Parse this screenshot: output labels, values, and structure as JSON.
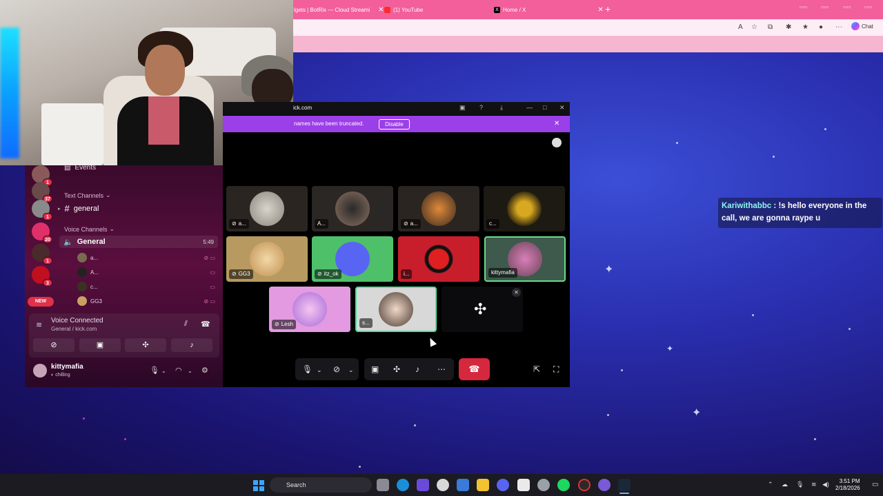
{
  "browser": {
    "tabs": [
      {
        "label": "lgets | BotRix — Cloud Streami"
      },
      {
        "label": "(1) YouTube"
      },
      {
        "label": "Home / X"
      }
    ],
    "chat_label": "Chat"
  },
  "popout": {
    "title": "ick.com",
    "notice_text": "names have been truncated.",
    "notice_button": "Disable"
  },
  "discord": {
    "events_label": "Events",
    "text_channels_label": "Text Channels",
    "text_channel": "general",
    "voice_channels_label": "Voice Channels",
    "voice_channel": "General",
    "voice_time": "5:49",
    "voice_users": [
      "a...",
      "A...",
      "c...",
      "GG3"
    ],
    "guild_badges": [
      "1",
      "37",
      "1",
      "20",
      "1",
      "3"
    ],
    "new_badge": "NEW",
    "voice_connected": "Voice Connected",
    "voice_connected_sub": "General / kick.com",
    "username": "kittymafia",
    "user_status": "chilling"
  },
  "tiles": [
    {
      "label": "a..."
    },
    {
      "label": "A..."
    },
    {
      "label": "a..."
    },
    {
      "label": "c..."
    },
    {
      "label": "GG3"
    },
    {
      "label": "itz_ok"
    },
    {
      "label": "i..."
    },
    {
      "label": "kittymafia"
    },
    {
      "label": "Lesh"
    },
    {
      "label": "s..."
    }
  ],
  "overlay": {
    "name": "Kariwithabbc",
    "message": " : !s hello everyone in the call, we are gonna raype u"
  },
  "taskbar": {
    "search_placeholder": "Search",
    "time": "3:51 PM",
    "date": "2/18/2026"
  },
  "colors": {
    "tab_bar": "#f25f9a",
    "discord_notice": "#9b3fe8",
    "hangup": "#d6283c",
    "speaking_border": "#4fe09a",
    "overlay_name": "#8ef5f0"
  }
}
